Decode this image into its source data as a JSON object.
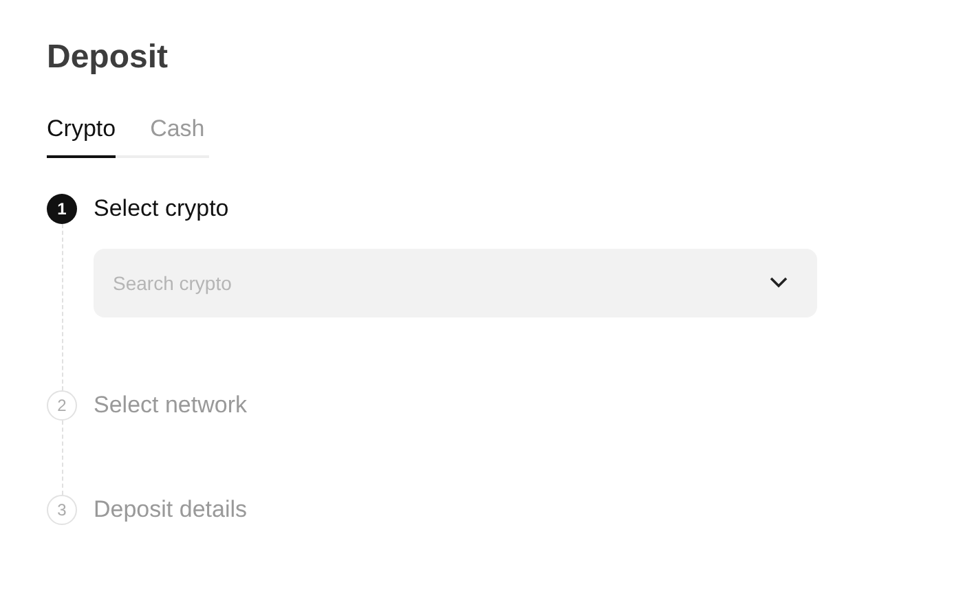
{
  "title": "Deposit",
  "tabs": [
    {
      "label": "Crypto",
      "selected": true
    },
    {
      "label": "Cash",
      "selected": false
    }
  ],
  "steps": [
    {
      "number": "1",
      "label": "Select crypto",
      "active": true,
      "field": {
        "placeholder": "Search crypto"
      }
    },
    {
      "number": "2",
      "label": "Select network",
      "active": false
    },
    {
      "number": "3",
      "label": "Deposit details",
      "active": false
    }
  ]
}
